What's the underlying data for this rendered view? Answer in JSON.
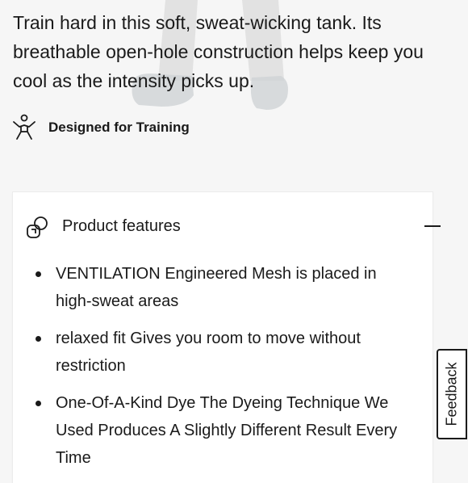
{
  "description": "Train hard in this soft, sweat-wicking tank. Its breathable open-hole construction helps keep you cool as the intensity picks up.",
  "activity": {
    "icon": "person-training-icon",
    "label": "Designed for Training"
  },
  "features_panel": {
    "icon": "features-icon",
    "title": "Product features",
    "collapse_icon": "minus-icon",
    "items": [
      "VENTILATION Engineered Mesh is placed in high-sweat areas",
      "relaxed fit Gives you room to move without restriction",
      "One-Of-A-Kind Dye The Dyeing Technique We Used Produces A Slightly Different Result Every Time"
    ]
  },
  "feedback_tab": {
    "label": "Feedback"
  },
  "colors": {
    "text": "#1a1a1a",
    "background": "#f6f6f6",
    "card": "#ffffff"
  }
}
